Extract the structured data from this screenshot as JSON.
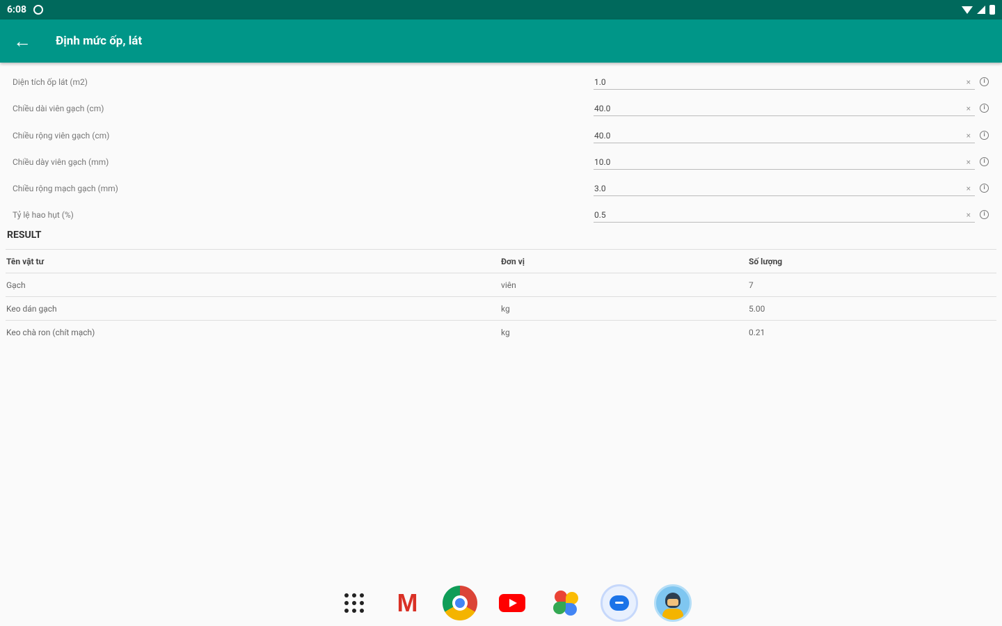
{
  "status_bar": {
    "time": "6:08"
  },
  "app_bar": {
    "title": "Định mức ốp, lát",
    "back_icon": "arrow-back-icon"
  },
  "form": {
    "fields": [
      {
        "label": "Diện tích ốp lát (m2)",
        "value": "1.0"
      },
      {
        "label": "Chiều dài viên gạch (cm)",
        "value": "40.0"
      },
      {
        "label": "Chiều rộng viên gạch (cm)",
        "value": "40.0"
      },
      {
        "label": "Chiều dày viên gạch (mm)",
        "value": "10.0"
      },
      {
        "label": "Chiều rộng mạch gạch (mm)",
        "value": "3.0"
      },
      {
        "label": "Tỷ lệ hao hụt (%)",
        "value": "0.5"
      }
    ],
    "clear_glyph": "×",
    "info_glyph": "i"
  },
  "result": {
    "title": "RESULT",
    "columns": [
      "Tên vật tư",
      "Đơn vị",
      "Số lượng"
    ],
    "rows": [
      [
        "Gạch",
        "viên",
        "7"
      ],
      [
        "Keo dán gạch",
        "kg",
        "5.00"
      ],
      [
        "Keo chà ron (chít mạch)",
        "kg",
        "0.21"
      ]
    ]
  },
  "dock": {
    "apps": [
      "app-drawer-icon",
      "gmail-icon",
      "chrome-icon",
      "youtube-icon",
      "photos-icon",
      "messages-icon",
      "avatar-app-icon"
    ],
    "gmail_glyph": "M"
  },
  "colors": {
    "status_bar": "#00695c",
    "app_bar": "#009688",
    "background": "#fafafa"
  }
}
